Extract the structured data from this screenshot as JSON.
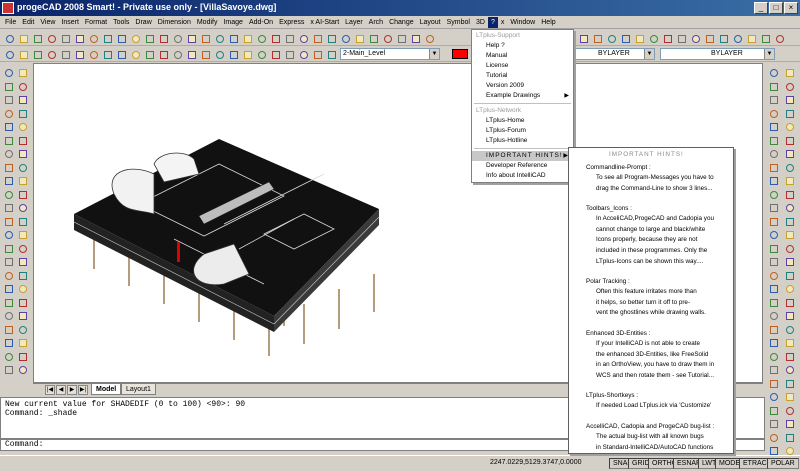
{
  "window": {
    "title": "progeCAD 2008 Smart! - Private use only - [VillaSavoye.dwg]",
    "controls": [
      "_",
      "□",
      "×"
    ]
  },
  "menubar": {
    "items": [
      "File",
      "Edit",
      "View",
      "Insert",
      "Format",
      "Tools",
      "Draw",
      "Dimension",
      "Modify",
      "Image",
      "Add-On",
      "Express",
      "x AI-Start",
      "Layer",
      "Arch",
      "Change",
      "Layout",
      "Symbol",
      "3D",
      "?",
      "x",
      "Window",
      "Help"
    ],
    "active_index": 19
  },
  "toolbar": {
    "layer_combo": "2-Main_Level",
    "linetype_combo": "BYLAYER",
    "lineweight_combo": "BYLAYER",
    "layer_color": "#ff0000"
  },
  "ltplus_menu": {
    "support_header": "LTplus-Support",
    "support_items": [
      "Help ?",
      "Manual",
      "License",
      "Tutorial",
      "Version 2009",
      "Example Drawings"
    ],
    "network_header": "LTplus-Network",
    "network_items": [
      "LTplus-Home",
      "LTplus-Forum",
      "LTplus-Hotline"
    ],
    "hints_item": "IMPORTANT HINTS!",
    "other_items": [
      "Developer Reference",
      "Info about IntelliCAD"
    ]
  },
  "hints_panel": {
    "title": "IMPORTANT HINTS!",
    "sections": [
      {
        "heading": "Commandline-Prompt :",
        "lines": [
          "To see all Program-Messages you have to",
          "drag the Command-Line to show 3 lines..."
        ]
      },
      {
        "heading": "Toolbars_Icons :",
        "lines": [
          "In AcceliCAD,ProgeCAD and Cadopia you",
          "cannot change to large and black/white",
          "Icons properly, because they are not",
          "included in these programmes. Only the",
          "LTplus-Icons can be shown this way...."
        ]
      },
      {
        "heading": "Polar Tracking :",
        "lines": [
          "Often this feature irritates more than",
          "it helps, so better turn it off to pre-",
          "vent the ghostlines while drawing walls."
        ]
      },
      {
        "heading": "Enhanced 3D-Entities :",
        "lines": [
          "If your IntelliCAD is not able to create",
          "the enhanced 3D-Entities, like FreeSolid",
          "in an OrthoView, you have to draw them in",
          "WCS and then rotate them - see Tutorial..."
        ]
      },
      {
        "heading": "LTplus-Shortkeys :",
        "lines": [
          "If needed Load LTplus.ick via 'Customize'"
        ]
      },
      {
        "heading": "AccelliCAD, Cadopia and ProgeCAD bug-list :",
        "lines": [
          "The actual bug-list with all known bugs",
          "in Standard-IntelliCAD/AutoCAD functions",
          "you can find in the file:  #_ReadMe.txt",
          ">>> Open ReadMe now..."
        ]
      }
    ]
  },
  "layout_tabs": [
    "Model",
    "Layout1"
  ],
  "command": {
    "history": [
      "New current value for SHADEDIF (0 to 100) <90>: 90",
      "Command: _shade"
    ],
    "prompt": "Command:"
  },
  "statusbar": {
    "coords": "2247.0229,5129.3747,0.0000",
    "buttons": [
      "SNAP",
      "GRID",
      "ORTHO",
      "ESNAP",
      "LWT",
      "MODEL",
      "ETRACK",
      "POLAR"
    ]
  }
}
